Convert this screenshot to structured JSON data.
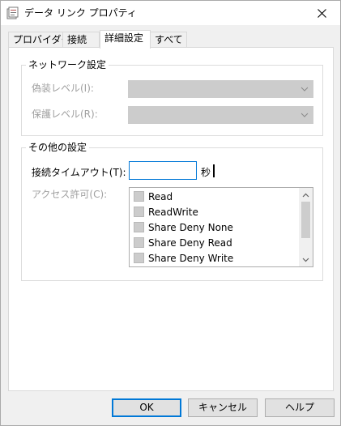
{
  "window": {
    "title": "データ リンク プロパティ"
  },
  "tabs": [
    {
      "label": "プロバイダー",
      "active": false
    },
    {
      "label": "接続",
      "active": false
    },
    {
      "label": "詳細設定",
      "active": true
    },
    {
      "label": "すべて",
      "active": false
    }
  ],
  "network": {
    "title": "ネットワーク設定",
    "impersonation_label": "偽装レベル(I):",
    "impersonation_value": "",
    "protection_label": "保護レベル(R):",
    "protection_value": ""
  },
  "other": {
    "title": "その他の設定",
    "timeout_label": "接続タイムアウト(T):",
    "timeout_value": "",
    "timeout_unit": "秒",
    "access_label": "アクセス許可(C):",
    "access_items": [
      {
        "label": "Read",
        "checked": false
      },
      {
        "label": "ReadWrite",
        "checked": false
      },
      {
        "label": "Share Deny None",
        "checked": false
      },
      {
        "label": "Share Deny Read",
        "checked": false
      },
      {
        "label": "Share Deny Write",
        "checked": false
      }
    ]
  },
  "buttons": {
    "ok": "OK",
    "cancel": "キャンセル",
    "help": "ヘルプ"
  },
  "colors": {
    "accent": "#0078d7",
    "disabled_field": "#cccccc",
    "disabled_text": "#a0a0a0"
  }
}
